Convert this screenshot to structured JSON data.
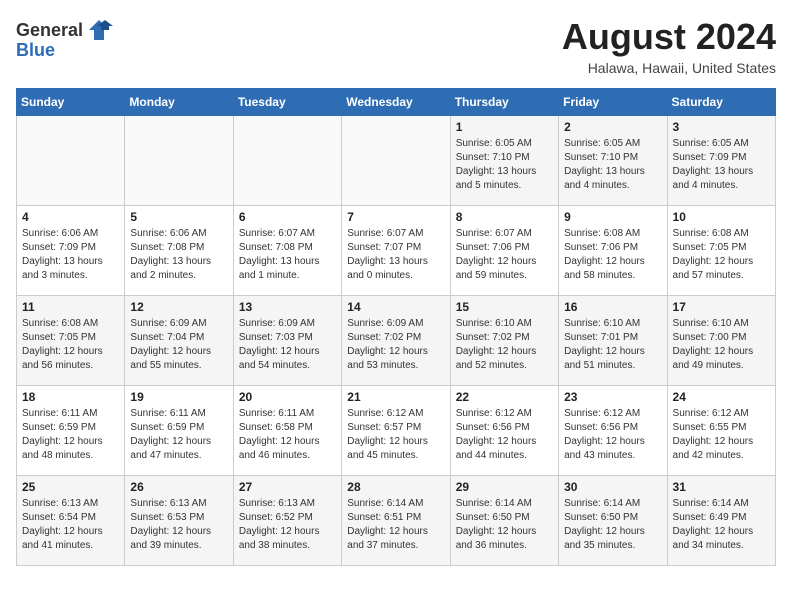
{
  "header": {
    "logo_general": "General",
    "logo_blue": "Blue",
    "month_year": "August 2024",
    "location": "Halawa, Hawaii, United States"
  },
  "days_of_week": [
    "Sunday",
    "Monday",
    "Tuesday",
    "Wednesday",
    "Thursday",
    "Friday",
    "Saturday"
  ],
  "weeks": [
    [
      {
        "day": "",
        "info": ""
      },
      {
        "day": "",
        "info": ""
      },
      {
        "day": "",
        "info": ""
      },
      {
        "day": "",
        "info": ""
      },
      {
        "day": "1",
        "info": "Sunrise: 6:05 AM\nSunset: 7:10 PM\nDaylight: 13 hours and 5 minutes."
      },
      {
        "day": "2",
        "info": "Sunrise: 6:05 AM\nSunset: 7:10 PM\nDaylight: 13 hours and 4 minutes."
      },
      {
        "day": "3",
        "info": "Sunrise: 6:05 AM\nSunset: 7:09 PM\nDaylight: 13 hours and 4 minutes."
      }
    ],
    [
      {
        "day": "4",
        "info": "Sunrise: 6:06 AM\nSunset: 7:09 PM\nDaylight: 13 hours and 3 minutes."
      },
      {
        "day": "5",
        "info": "Sunrise: 6:06 AM\nSunset: 7:08 PM\nDaylight: 13 hours and 2 minutes."
      },
      {
        "day": "6",
        "info": "Sunrise: 6:07 AM\nSunset: 7:08 PM\nDaylight: 13 hours and 1 minute."
      },
      {
        "day": "7",
        "info": "Sunrise: 6:07 AM\nSunset: 7:07 PM\nDaylight: 13 hours and 0 minutes."
      },
      {
        "day": "8",
        "info": "Sunrise: 6:07 AM\nSunset: 7:06 PM\nDaylight: 12 hours and 59 minutes."
      },
      {
        "day": "9",
        "info": "Sunrise: 6:08 AM\nSunset: 7:06 PM\nDaylight: 12 hours and 58 minutes."
      },
      {
        "day": "10",
        "info": "Sunrise: 6:08 AM\nSunset: 7:05 PM\nDaylight: 12 hours and 57 minutes."
      }
    ],
    [
      {
        "day": "11",
        "info": "Sunrise: 6:08 AM\nSunset: 7:05 PM\nDaylight: 12 hours and 56 minutes."
      },
      {
        "day": "12",
        "info": "Sunrise: 6:09 AM\nSunset: 7:04 PM\nDaylight: 12 hours and 55 minutes."
      },
      {
        "day": "13",
        "info": "Sunrise: 6:09 AM\nSunset: 7:03 PM\nDaylight: 12 hours and 54 minutes."
      },
      {
        "day": "14",
        "info": "Sunrise: 6:09 AM\nSunset: 7:02 PM\nDaylight: 12 hours and 53 minutes."
      },
      {
        "day": "15",
        "info": "Sunrise: 6:10 AM\nSunset: 7:02 PM\nDaylight: 12 hours and 52 minutes."
      },
      {
        "day": "16",
        "info": "Sunrise: 6:10 AM\nSunset: 7:01 PM\nDaylight: 12 hours and 51 minutes."
      },
      {
        "day": "17",
        "info": "Sunrise: 6:10 AM\nSunset: 7:00 PM\nDaylight: 12 hours and 49 minutes."
      }
    ],
    [
      {
        "day": "18",
        "info": "Sunrise: 6:11 AM\nSunset: 6:59 PM\nDaylight: 12 hours and 48 minutes."
      },
      {
        "day": "19",
        "info": "Sunrise: 6:11 AM\nSunset: 6:59 PM\nDaylight: 12 hours and 47 minutes."
      },
      {
        "day": "20",
        "info": "Sunrise: 6:11 AM\nSunset: 6:58 PM\nDaylight: 12 hours and 46 minutes."
      },
      {
        "day": "21",
        "info": "Sunrise: 6:12 AM\nSunset: 6:57 PM\nDaylight: 12 hours and 45 minutes."
      },
      {
        "day": "22",
        "info": "Sunrise: 6:12 AM\nSunset: 6:56 PM\nDaylight: 12 hours and 44 minutes."
      },
      {
        "day": "23",
        "info": "Sunrise: 6:12 AM\nSunset: 6:56 PM\nDaylight: 12 hours and 43 minutes."
      },
      {
        "day": "24",
        "info": "Sunrise: 6:12 AM\nSunset: 6:55 PM\nDaylight: 12 hours and 42 minutes."
      }
    ],
    [
      {
        "day": "25",
        "info": "Sunrise: 6:13 AM\nSunset: 6:54 PM\nDaylight: 12 hours and 41 minutes."
      },
      {
        "day": "26",
        "info": "Sunrise: 6:13 AM\nSunset: 6:53 PM\nDaylight: 12 hours and 39 minutes."
      },
      {
        "day": "27",
        "info": "Sunrise: 6:13 AM\nSunset: 6:52 PM\nDaylight: 12 hours and 38 minutes."
      },
      {
        "day": "28",
        "info": "Sunrise: 6:14 AM\nSunset: 6:51 PM\nDaylight: 12 hours and 37 minutes."
      },
      {
        "day": "29",
        "info": "Sunrise: 6:14 AM\nSunset: 6:50 PM\nDaylight: 12 hours and 36 minutes."
      },
      {
        "day": "30",
        "info": "Sunrise: 6:14 AM\nSunset: 6:50 PM\nDaylight: 12 hours and 35 minutes."
      },
      {
        "day": "31",
        "info": "Sunrise: 6:14 AM\nSunset: 6:49 PM\nDaylight: 12 hours and 34 minutes."
      }
    ]
  ]
}
